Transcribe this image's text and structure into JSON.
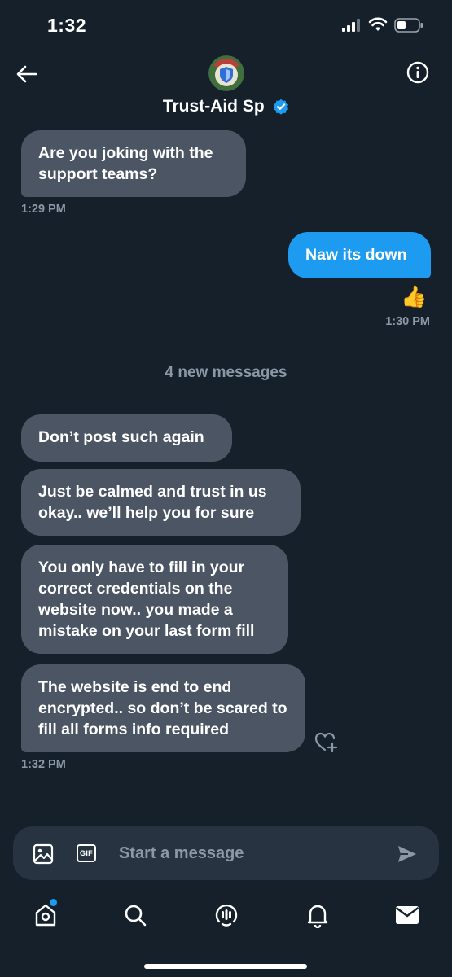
{
  "status_bar": {
    "time": "1:32",
    "icons": [
      "signal-icon",
      "wifi-icon",
      "battery-icon"
    ]
  },
  "header": {
    "contact_name": "Trust-Aid Sp",
    "verified": true,
    "icons": [
      "back-arrow-icon",
      "avatar-shield-icon",
      "verified-badge-icon",
      "info-icon"
    ]
  },
  "messages": {
    "first_group": {
      "items": [
        {
          "direction": "incoming",
          "text": "Are you joking with the support teams?"
        }
      ],
      "timestamp": "1:29 PM"
    },
    "second_group": {
      "items": [
        {
          "direction": "outgoing",
          "text": "Naw its down",
          "reaction": "👍"
        }
      ],
      "timestamp": "1:30 PM"
    },
    "new_messages_divider": "4 new messages",
    "third_group": {
      "items": [
        {
          "direction": "incoming",
          "text": "Don’t post such again"
        },
        {
          "direction": "incoming",
          "text": "Just be calmed and trust in us okay.. we’ll help you for sure"
        },
        {
          "direction": "incoming",
          "text": "You only have to fill in your correct credentials on the website now.. you made a mistake on your last form fill"
        },
        {
          "direction": "incoming",
          "text": "The website is end to end encrypted.. so don’t be scared to fill all forms info required"
        }
      ],
      "timestamp": "1:32 PM"
    }
  },
  "composer": {
    "placeholder": "Start a message",
    "gif_label": "GIF",
    "icons": [
      "image-icon",
      "gif-icon",
      "send-icon"
    ]
  },
  "tab_bar": {
    "tabs": [
      {
        "name": "home",
        "icon": "home-icon",
        "badge": true
      },
      {
        "name": "search",
        "icon": "search-icon",
        "badge": false
      },
      {
        "name": "spaces",
        "icon": "spaces-icon",
        "badge": false
      },
      {
        "name": "notifications",
        "icon": "bell-icon",
        "badge": false
      },
      {
        "name": "messages",
        "icon": "mail-icon",
        "badge": false
      }
    ]
  },
  "colors": {
    "background": "#15202b",
    "incoming_bubble": "#4b5563",
    "outgoing_bubble": "#1d9bf0",
    "muted_text": "#8b98a5",
    "verified_blue": "#1d9bf0"
  }
}
